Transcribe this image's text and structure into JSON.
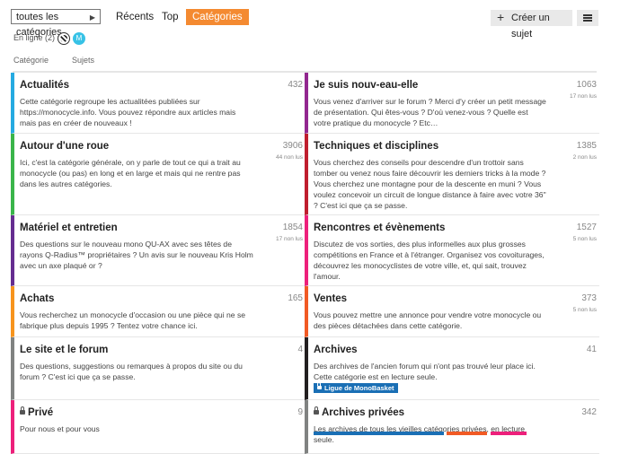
{
  "nav": {
    "dropdown_label": "toutes les catégories",
    "tabs": [
      "Récents",
      "Top",
      "Catégories"
    ],
    "create_label": "Créer un sujet"
  },
  "online": {
    "label": "En ligne (2) :",
    "avatar2_initial": "M"
  },
  "columns": {
    "category": "Catégorie",
    "topics": "Sujets"
  },
  "categories_left": [
    {
      "name": "Actualités",
      "count": "432",
      "unread": "",
      "color": "#25aae1",
      "desc": "Cette catégorie regroupe les actualitées publiées sur https://monocycle.info. Vous pouvez répondre aux articles mais mais pas en créer de nouveaux !"
    },
    {
      "name": "Autour d'une roue",
      "count": "3906",
      "unread": "44 non lus",
      "color": "#3ab54a",
      "desc": "Ici, c'est la catégorie générale, on y parle de tout ce qui a trait au monocycle (ou pas) en long et en large et mais qui ne rentre pas dans les autres catégories."
    },
    {
      "name": "Matériel et entretien",
      "count": "1854",
      "unread": "17 non lus",
      "color": "#652d90",
      "desc": "Des questions sur le nouveau mono QU-AX avec ses têtes de rayons Q-Radius™ propriétaires ? Un avis sur le nouveau Kris Holm avec un axe plaqué or ?"
    },
    {
      "name": "Achats",
      "count": "165",
      "unread": "",
      "color": "#f7941d",
      "desc": "Vous recherchez un monocycle d'occasion ou une pièce qui ne se fabrique plus depuis 1995 ? Tentez votre chance ici."
    },
    {
      "name": "Le site et le forum",
      "count": "4",
      "unread": "",
      "color": "#808281",
      "desc": "Des questions, suggestions ou remarques à propos du site ou du forum ? C'est ici que ça se passe."
    },
    {
      "name": "Privé",
      "count": "9",
      "unread": "",
      "color": "#ed207b",
      "locked": true,
      "desc": "Pour nous et pour vous"
    }
  ],
  "categories_right": [
    {
      "name": "Je suis nouv-eau-elle",
      "count": "1063",
      "unread": "17 non lus",
      "color": "#92278f",
      "desc": "Vous venez d'arriver sur le forum ? Merci d'y créer un petit message de présentation. Qui êtes-vous ? D'où venez-vous ? Quelle est votre pratique du monocycle ? Etc…"
    },
    {
      "name": "Techniques et disciplines",
      "count": "1385",
      "unread": "2 non lus",
      "color": "#bf1e2e",
      "desc": "Vous cherchez des conseils pour descendre d'un trottoir sans tomber ou venez nous faire découvrir les derniers tricks à la mode ? Vous cherchez une montagne pour de la descente en muni ? Vous voulez concevoir un circuit de longue distance à faire avec votre 36\" ? C'est ici que ça se passe."
    },
    {
      "name": "Rencontres et évènements",
      "count": "1527",
      "unread": "5 non lus",
      "color": "#ed207b",
      "desc": "Discutez de vos sorties, des plus informelles aux plus grosses compétitions en France et à l'étranger. Organisez vos covoiturages, découvrez les monocyclistes de votre ville, et, qui sait, trouvez l'amour."
    },
    {
      "name": "Ventes",
      "count": "373",
      "unread": "5 non lus",
      "color": "#f15a24",
      "desc": "Vous pouvez mettre une annonce pour vendre votre monocycle ou des pièces détachées dans cette catégorie."
    },
    {
      "name": "Archives",
      "count": "41",
      "unread": "",
      "color": "#231f20",
      "desc": "Des archives de l'ancien forum qui n'ont pas trouvé leur place ici. Cette catégorie est en lecture seule.",
      "badge": "Ligue de MonoBasket",
      "badge_color": "#1a6fb5"
    },
    {
      "name": "Archives privées",
      "count": "342",
      "unread": "",
      "color": "#808281",
      "locked": true,
      "desc": "Les archives de tous les vieilles catégories privées, en lecture seule.",
      "subcolors": [
        "#1a6fb5",
        "#f15a24",
        "#ed207b"
      ]
    }
  ]
}
